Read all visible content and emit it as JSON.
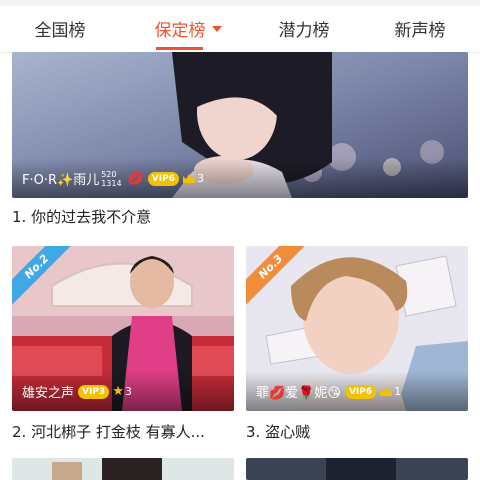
{
  "tabs": [
    {
      "label": "全国榜",
      "active": false
    },
    {
      "label": "保定榜",
      "active": true
    },
    {
      "label": "潜力榜",
      "active": false
    },
    {
      "label": "新声榜",
      "active": false
    }
  ],
  "cards": [
    {
      "nickname": "F·O·R✨雨儿",
      "sup": "520",
      "sub": "1314",
      "vip": "VIP6",
      "level": "3",
      "caption": "1. 你的过去我不介意"
    },
    {
      "rank_badge": "No.2",
      "nickname": "雄安之声",
      "vip": "VIP3",
      "level": "3",
      "caption": "2. 河北梆子 打金枝 有寡人..."
    },
    {
      "rank_badge": "No.3",
      "nickname": "罪💋爱🌹妮😘",
      "vip": "VIP6",
      "level": "1",
      "caption": "3. 盗心贼"
    }
  ],
  "colors": {
    "accent": "#f0522e",
    "no2": "#3fa9e8",
    "no3": "#f08c3a",
    "vip": "#f2c200"
  }
}
